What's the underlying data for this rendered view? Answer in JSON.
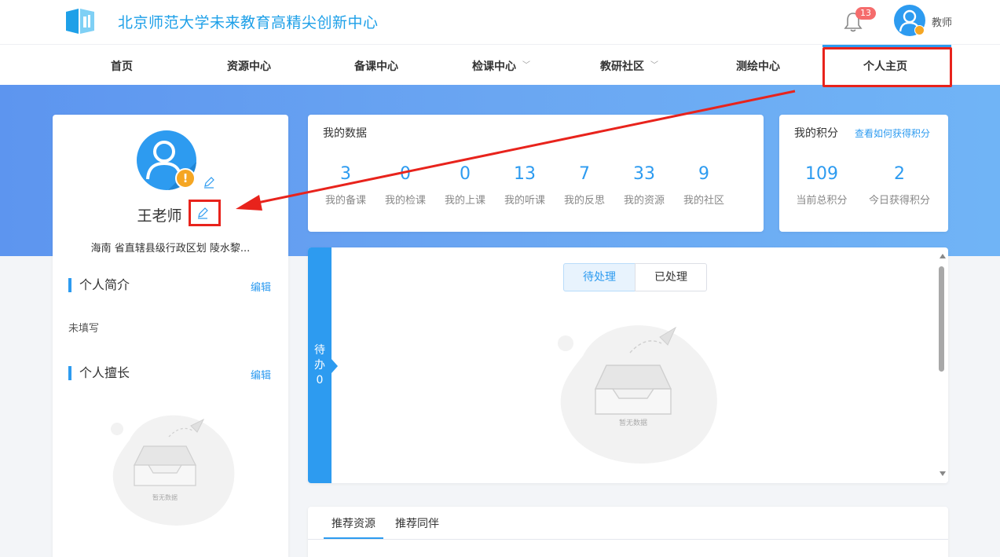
{
  "header": {
    "site_title": "北京师范大学未来教育高精尖创新中心",
    "notification_count": "13",
    "role": "教师"
  },
  "nav": {
    "items": [
      {
        "label": "首页",
        "has_dropdown": false
      },
      {
        "label": "资源中心",
        "has_dropdown": false
      },
      {
        "label": "备课中心",
        "has_dropdown": false
      },
      {
        "label": "检课中心",
        "has_dropdown": true
      },
      {
        "label": "教研社区",
        "has_dropdown": true
      },
      {
        "label": "测绘中心",
        "has_dropdown": false
      },
      {
        "label": "个人主页",
        "has_dropdown": false
      }
    ],
    "active": "个人主页"
  },
  "profile": {
    "name": "王老师",
    "school": "海南 省直辖县级行政区划 陵水黎...",
    "intro_title": "个人简介",
    "intro_edit": "编辑",
    "intro_text": "未填写",
    "skills_title": "个人擅长",
    "skills_edit": "编辑",
    "empty_text": "暂无数据"
  },
  "my_data": {
    "title": "我的数据",
    "stats": [
      {
        "value": "3",
        "label": "我的备课"
      },
      {
        "value": "0",
        "label": "我的检课"
      },
      {
        "value": "0",
        "label": "我的上课"
      },
      {
        "value": "13",
        "label": "我的听课"
      },
      {
        "value": "7",
        "label": "我的反思"
      },
      {
        "value": "33",
        "label": "我的资源"
      },
      {
        "value": "9",
        "label": "我的社区"
      }
    ]
  },
  "points": {
    "title": "我的积分",
    "link": "查看如何获得积分",
    "stats": [
      {
        "value": "109",
        "label": "当前总积分"
      },
      {
        "value": "2",
        "label": "今日获得积分"
      }
    ]
  },
  "todo": {
    "side_line1": "待",
    "side_line2": "办",
    "side_count": "0",
    "tab_pending": "待处理",
    "tab_done": "已处理",
    "empty_text": "暂无数据"
  },
  "recommend": {
    "tabs": [
      "推荐资源",
      "推荐同伴"
    ]
  },
  "colors": {
    "accent": "#2d9bf0",
    "title_blue": "#1ea0e8",
    "annotation_red": "#e8231c",
    "warning": "#f5a623"
  }
}
